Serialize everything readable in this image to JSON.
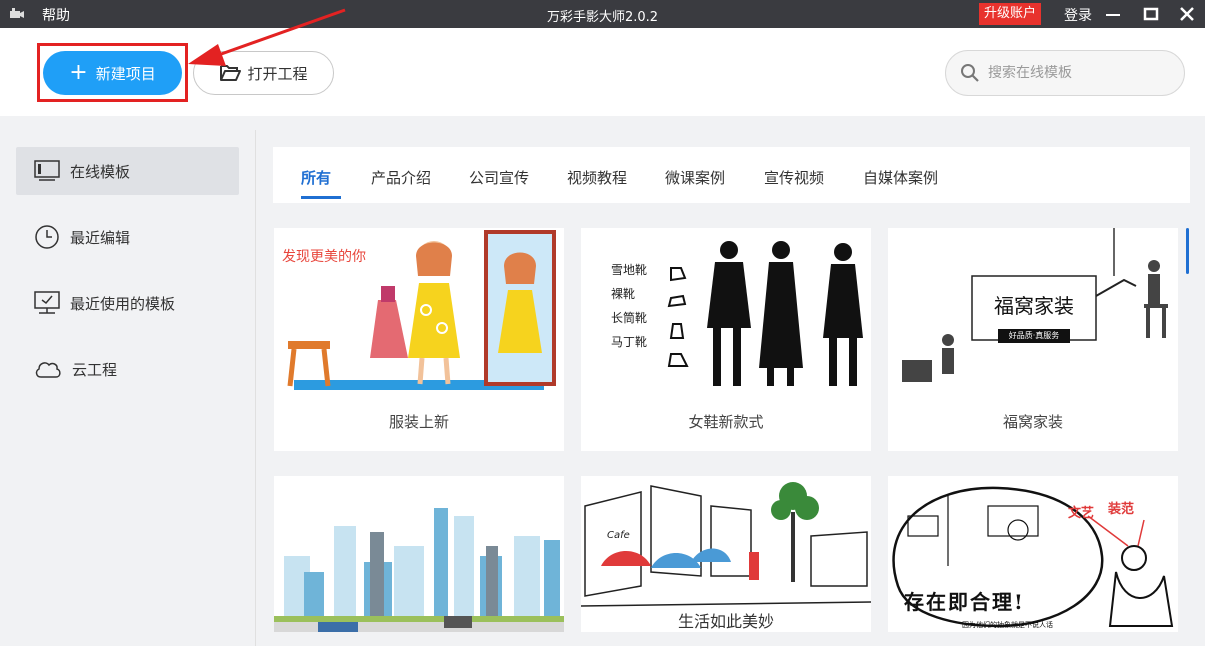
{
  "titlebar": {
    "help": "帮助",
    "title": "万彩手影大师2.0.2",
    "upgrade": "升级账户",
    "login": "登录"
  },
  "toolbar": {
    "new_project": "新建项目",
    "open_project": "打开工程",
    "search_placeholder": "搜索在线模板"
  },
  "sidebar": {
    "items": [
      {
        "label": "在线模板",
        "icon": "monitor-icon"
      },
      {
        "label": "最近编辑",
        "icon": "clock-icon"
      },
      {
        "label": "最近使用的模板",
        "icon": "template-icon"
      },
      {
        "label": "云工程",
        "icon": "cloud-icon"
      }
    ]
  },
  "tabs": [
    "所有",
    "产品介绍",
    "公司宣传",
    "视频教程",
    "微课案例",
    "宣传视频",
    "自媒体案例"
  ],
  "cards": [
    {
      "caption": "服装上新",
      "thumb_text": "发现更美的你"
    },
    {
      "caption": "女鞋新款式",
      "thumb_text": [
        "雪地靴",
        "裸靴",
        "长筒靴",
        "马丁靴"
      ]
    },
    {
      "caption": "福窝家装",
      "thumb_text": [
        "福窝家装",
        "好品质·真服务"
      ]
    },
    {
      "caption": "",
      "thumb_text": ""
    },
    {
      "caption": "",
      "thumb_text": [
        "Cafe",
        "生活如此美妙"
      ]
    },
    {
      "caption": "",
      "thumb_text": [
        "存在即合理!",
        "装范",
        "文艺",
        "因为他们的抽象就是不说人话"
      ]
    }
  ],
  "colors": {
    "accent": "#1f9ff7",
    "tab_active": "#1f6fd2",
    "titlebar": "#3a3b40",
    "upgrade": "#e8322d",
    "annotation": "#e32222"
  }
}
